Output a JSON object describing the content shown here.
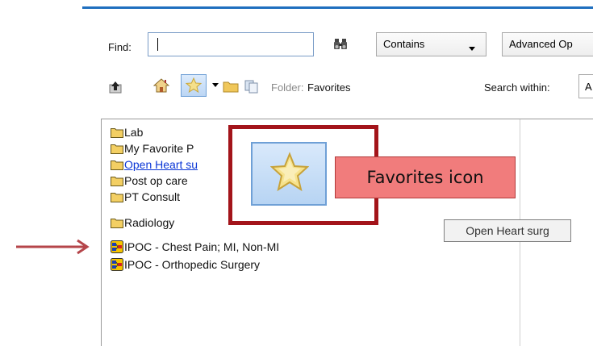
{
  "toolbar": {
    "find_label": "Find:",
    "find_value": "",
    "match_mode": "Contains",
    "advanced_label": "Advanced Op",
    "folder_prefix": "Folder:",
    "folder_name": "Favorites",
    "search_within_label": "Search within:",
    "search_within_value": "A"
  },
  "tree": {
    "items": [
      {
        "label": "Lab",
        "icon": "folder-icon"
      },
      {
        "label": "My Favorite P",
        "icon": "folder-icon"
      },
      {
        "label": "Open Heart su",
        "icon": "folder-icon",
        "link": true
      },
      {
        "label": "Post op care",
        "icon": "folder-icon"
      },
      {
        "label": "PT Consult",
        "icon": "folder-icon"
      },
      {
        "label": "Radiology",
        "icon": "folder-icon"
      },
      {
        "label": "IPOC - Chest Pain; MI, Non-MI",
        "icon": "ipoc-icon"
      },
      {
        "label": "IPOC - Orthopedic Surgery",
        "icon": "ipoc-icon"
      }
    ]
  },
  "callout": {
    "label": "Favorites icon"
  },
  "tooltip": {
    "text": "Open Heart surg"
  },
  "colors": {
    "callout_border": "#a3141a",
    "callout_fill": "#f17c7c",
    "arrow": "#b5454a",
    "link": "#0a36d6"
  }
}
